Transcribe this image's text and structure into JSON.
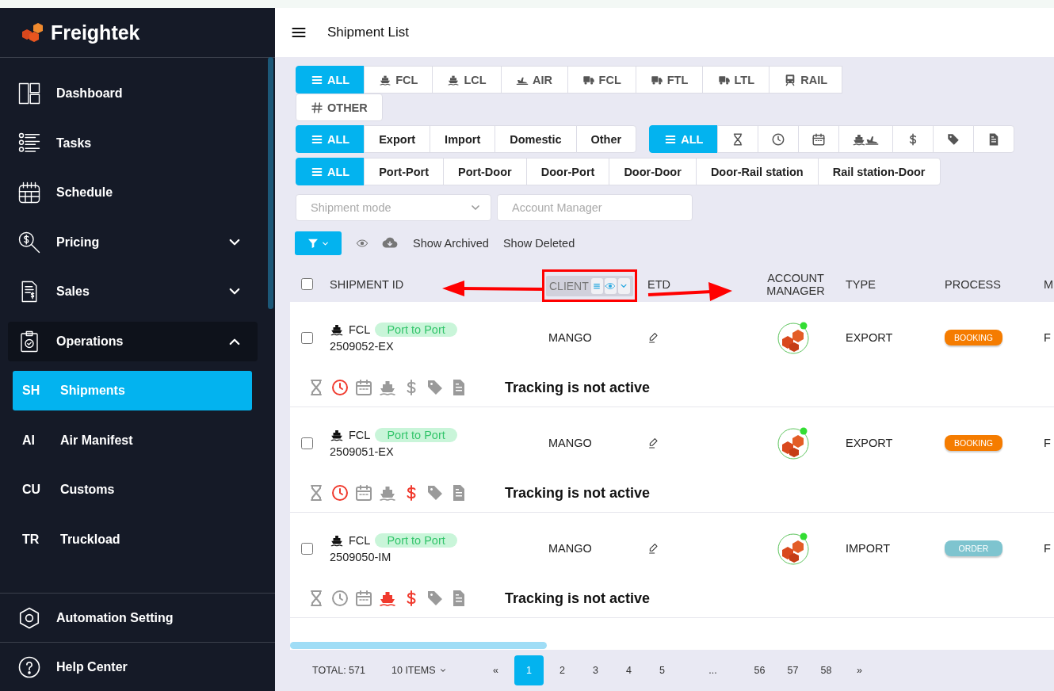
{
  "brand": {
    "name": "Freightek"
  },
  "sidebar": {
    "items": [
      {
        "label": "Dashboard",
        "kind": "dashboard"
      },
      {
        "label": "Tasks",
        "kind": "tasks"
      },
      {
        "label": "Schedule",
        "kind": "schedule"
      },
      {
        "label": "Pricing",
        "kind": "pricing",
        "expanded": false
      },
      {
        "label": "Sales",
        "kind": "sales",
        "expanded": false
      },
      {
        "label": "Operations",
        "kind": "operations",
        "expanded": true,
        "children": [
          {
            "abbr": "SH",
            "label": "Shipments",
            "selected": true
          },
          {
            "abbr": "AI",
            "label": "Air Manifest",
            "selected": false
          },
          {
            "abbr": "CU",
            "label": "Customs",
            "selected": false
          },
          {
            "abbr": "TR",
            "label": "Truckload",
            "selected": false
          }
        ]
      }
    ],
    "footer_items": [
      {
        "label": "Automation Setting",
        "kind": "automation"
      },
      {
        "label": "Help Center",
        "kind": "help"
      }
    ]
  },
  "header": {
    "title": "Shipment List"
  },
  "mode_tabs": [
    {
      "kind": "list",
      "label": "ALL",
      "selected": true
    },
    {
      "kind": "ship",
      "label": "FCL",
      "selected": false
    },
    {
      "kind": "ship",
      "label": "LCL",
      "selected": false
    },
    {
      "kind": "plane",
      "label": "AIR",
      "selected": false
    },
    {
      "kind": "truck",
      "label": "FCL",
      "selected": false
    },
    {
      "kind": "truck",
      "label": "FTL",
      "selected": false
    },
    {
      "kind": "truck",
      "label": "LTL",
      "selected": false
    },
    {
      "kind": "train",
      "label": "RAIL",
      "selected": false
    },
    {
      "kind": "hash",
      "label": "OTHER",
      "selected": false
    }
  ],
  "direction_tabs": [
    {
      "kind": "list",
      "label": "ALL",
      "selected": true
    },
    {
      "label": "Export",
      "selected": false
    },
    {
      "label": "Import",
      "selected": false
    },
    {
      "label": "Domestic",
      "selected": false
    },
    {
      "label": "Other",
      "selected": false
    }
  ],
  "status_tabs": [
    {
      "kind": "list",
      "label": "ALL",
      "selected": true
    },
    {
      "kind": "hourglass",
      "selected": false
    },
    {
      "kind": "clock",
      "selected": false
    },
    {
      "kind": "calendar",
      "selected": false
    },
    {
      "kind": "ship-plane",
      "selected": false
    },
    {
      "kind": "dollar",
      "selected": false
    },
    {
      "kind": "tag",
      "selected": false
    },
    {
      "kind": "document",
      "selected": false
    }
  ],
  "route_tabs": [
    {
      "kind": "list",
      "label": "ALL",
      "selected": true
    },
    {
      "label": "Port-Port",
      "selected": false
    },
    {
      "label": "Port-Door",
      "selected": false
    },
    {
      "label": "Door-Port",
      "selected": false
    },
    {
      "label": "Door-Door",
      "selected": false
    },
    {
      "label": "Door-Rail station",
      "selected": false
    },
    {
      "label": "Rail station-Door",
      "selected": false
    }
  ],
  "fields": [
    {
      "kind": "dropdown",
      "placeholder": "Shipment mode"
    },
    {
      "kind": "text",
      "placeholder": "Account Manager"
    }
  ],
  "toolbar": {
    "links": [
      "Show Archived",
      "Show Deleted"
    ]
  },
  "table": {
    "select_all": {
      "checked": false
    },
    "columns": [
      {
        "label": "SHIPMENT ID",
        "dragging": false
      },
      {
        "label": "CLIENT",
        "dragging": true
      },
      {
        "label": "ETD",
        "dragging": false
      },
      {
        "label": "ACCOUNT MANAGER",
        "dragging": false
      },
      {
        "label": "TYPE",
        "dragging": false
      },
      {
        "label": "PROCESS",
        "dragging": false
      },
      {
        "label": "M",
        "dragging": false
      }
    ],
    "rows": [
      {
        "checked": false,
        "mode": "FCL",
        "route": "Port to Port",
        "id": "2509052-EX",
        "client": "MANGO",
        "type": "EXPORT",
        "process": {
          "label": "BOOKING",
          "color": "#f57c00"
        },
        "column_8": "F",
        "status_icons": [
          {
            "kind": "hourglass",
            "alert": false
          },
          {
            "kind": "clock",
            "alert": true
          },
          {
            "kind": "calendar",
            "alert": false
          },
          {
            "kind": "ship",
            "alert": false
          },
          {
            "kind": "dollar",
            "alert": false
          },
          {
            "kind": "tag",
            "alert": false
          },
          {
            "kind": "document",
            "alert": false
          }
        ],
        "tracking": "Tracking is not active"
      },
      {
        "checked": false,
        "mode": "FCL",
        "route": "Port to Port",
        "id": "2509051-EX",
        "client": "MANGO",
        "type": "EXPORT",
        "process": {
          "label": "BOOKING",
          "color": "#f57c00"
        },
        "column_8": "F",
        "status_icons": [
          {
            "kind": "hourglass",
            "alert": false
          },
          {
            "kind": "clock",
            "alert": true
          },
          {
            "kind": "calendar",
            "alert": false
          },
          {
            "kind": "ship",
            "alert": false
          },
          {
            "kind": "dollar",
            "alert": true
          },
          {
            "kind": "tag",
            "alert": false
          },
          {
            "kind": "document",
            "alert": false
          }
        ],
        "tracking": "Tracking is not active"
      },
      {
        "checked": false,
        "mode": "FCL",
        "route": "Port to Port",
        "id": "2509050-IM",
        "client": "MANGO",
        "type": "IMPORT",
        "process": {
          "label": "ORDER",
          "color": "#7ec4cf"
        },
        "column_8": "F",
        "status_icons": [
          {
            "kind": "hourglass",
            "alert": false
          },
          {
            "kind": "clock",
            "alert": false
          },
          {
            "kind": "calendar",
            "alert": false
          },
          {
            "kind": "ship",
            "alert": true
          },
          {
            "kind": "dollar",
            "alert": true
          },
          {
            "kind": "tag",
            "alert": false
          },
          {
            "kind": "document",
            "alert": false
          }
        ],
        "tracking": "Tracking is not active"
      }
    ]
  },
  "pagination": {
    "total": "TOTAL: 571",
    "page_size": "10 ITEMS",
    "prev": "«",
    "next": "»",
    "pages": [
      {
        "label": "1",
        "selected": true
      },
      {
        "label": "2",
        "selected": false
      },
      {
        "label": "3",
        "selected": false
      },
      {
        "label": "4",
        "selected": false
      },
      {
        "label": "5",
        "selected": false
      },
      {
        "label": "...",
        "selected": false
      },
      {
        "label": "56",
        "selected": false
      },
      {
        "label": "57",
        "selected": false
      },
      {
        "label": "58",
        "selected": false
      }
    ]
  }
}
